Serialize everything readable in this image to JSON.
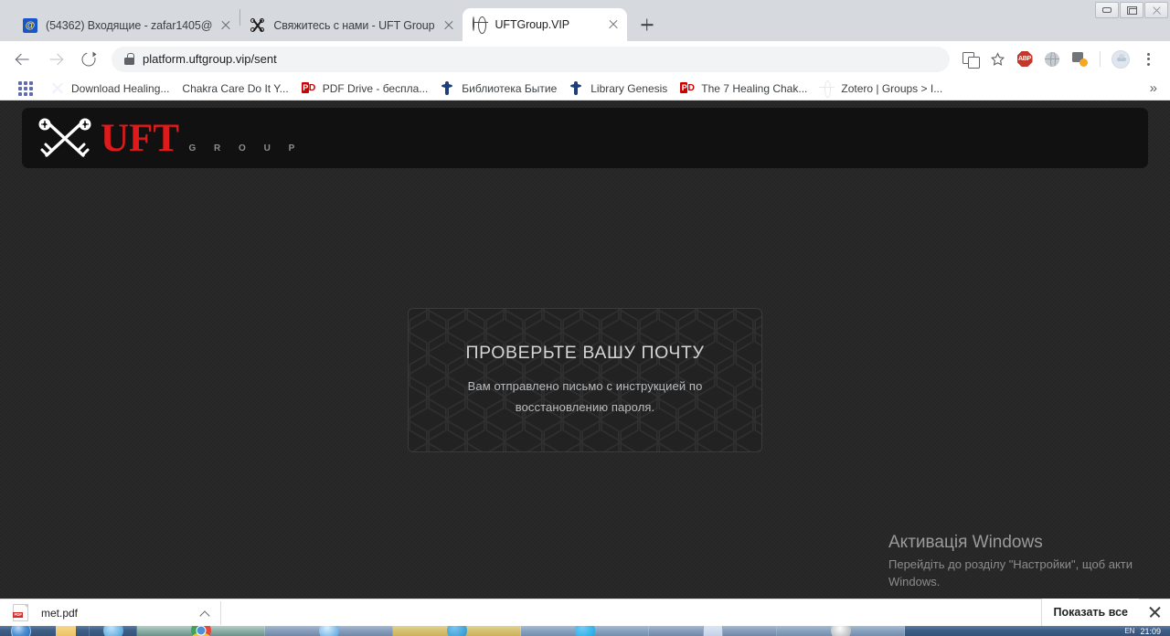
{
  "window": {
    "controls": [
      {
        "name": "minimize",
        "label": "–"
      },
      {
        "name": "restore",
        "label": "❐"
      },
      {
        "name": "close",
        "label": "✕"
      }
    ]
  },
  "tabs": [
    {
      "title": "(54362) Входящие - zafar1405@",
      "favicon": "mail-at-icon",
      "active": false
    },
    {
      "title": "Свяжитесь с нами - UFT Group",
      "favicon": "crossed-keys-icon",
      "active": false
    },
    {
      "title": "UFTGroup.VIP",
      "favicon": "globe-icon",
      "active": true
    }
  ],
  "newtab_label": "+",
  "toolbar": {
    "back_icon": "back-arrow-icon",
    "forward_icon": "forward-arrow-icon",
    "reload_icon": "reload-icon",
    "lock_icon": "lock-icon",
    "url": "platform.uftgroup.vip/sent",
    "icons": [
      {
        "name": "translate-icon"
      },
      {
        "name": "bookmark-star-icon"
      },
      {
        "name": "adblock-plus-icon",
        "label": "ABP"
      },
      {
        "name": "globe-extension-icon"
      },
      {
        "name": "download-extension-icon"
      },
      {
        "name": "profile-avatar"
      },
      {
        "name": "chrome-menu-icon"
      }
    ]
  },
  "bookmarks": {
    "apps_icon": "apps-grid-icon",
    "items": [
      {
        "label": "Download Healing...",
        "icon": "snowflake-icon"
      },
      {
        "label": "Chakra Care Do It Y...",
        "icon": "none"
      },
      {
        "label": "PDF Drive - беспла...",
        "icon": "pdf-icon"
      },
      {
        "label": "Библиотека Бытие",
        "icon": "book-icon"
      },
      {
        "label": "Library Genesis",
        "icon": "book-icon"
      },
      {
        "label": "The 7 Healing Chak...",
        "icon": "pdf-icon"
      },
      {
        "label": "Zotero | Groups > I...",
        "icon": "zotero-globe-icon"
      }
    ],
    "overflow_label": "»"
  },
  "site": {
    "logo": {
      "brand": "UFT",
      "subtitle": "G R O U P",
      "icon": "crossed-keys-logo",
      "brand_color": "#e01a1a",
      "subtitle_color": "#8d8d8d"
    },
    "card": {
      "title": "ПРОВЕРЬТЕ ВАШУ ПОЧТУ",
      "text": "Вам отправлено письмо с инструкцией по восстановлению пароля.",
      "background_color": "#222222",
      "border_color": "#3a3a3a"
    },
    "page_background": "#262626",
    "header_background": "#111111"
  },
  "watermark": {
    "title": "Активація Windows",
    "subtitle": "Перейдіть до розділу \"Настройки\", щоб акти Windows."
  },
  "downloads": {
    "file_name": "met.pdf",
    "file_icon": "pdf-file-icon",
    "chevron_icon": "chevron-up-icon",
    "show_all_label": "Показать все",
    "close_icon": "close-icon"
  },
  "taskbar": {
    "start_icon": "windows-start-orb",
    "pinned": [
      {
        "name": "explorer-taskbar-icon"
      },
      {
        "name": "ie-taskbar-icon"
      }
    ],
    "windows": [
      {
        "name": "chrome-window-button"
      },
      {
        "name": "ie-window-button"
      },
      {
        "name": "telegram-window-button"
      },
      {
        "name": "skype-window-button"
      },
      {
        "name": "word-window-button"
      },
      {
        "name": "eagle-window-button"
      }
    ],
    "language": "EN",
    "clock": "21:09"
  }
}
